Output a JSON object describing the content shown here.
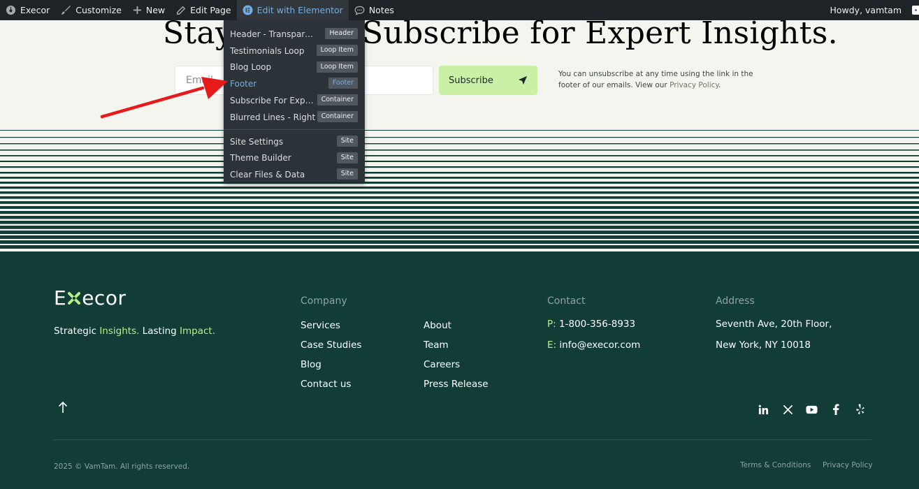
{
  "adminbar": {
    "site_name": "Execor",
    "customize": "Customize",
    "new": "New",
    "edit_page": "Edit Page",
    "edit_elementor": "Edit with Elementor",
    "notes": "Notes",
    "howdy": "Howdy, vamtam"
  },
  "dropdown": {
    "items": [
      {
        "label": "Header - Transparent",
        "tag": "Header"
      },
      {
        "label": "Testimonials Loop",
        "tag": "Loop Item"
      },
      {
        "label": "Blog Loop",
        "tag": "Loop Item"
      },
      {
        "label": "Footer",
        "tag": "Footer"
      },
      {
        "label": "Subscribe For Expert Insights",
        "tag": "Container"
      },
      {
        "label": "Blurred Lines - Right",
        "tag": "Container"
      }
    ],
    "site_items": [
      {
        "label": "Site Settings",
        "tag": "Site"
      },
      {
        "label": "Theme Builder",
        "tag": "Site"
      },
      {
        "label": "Clear Files & Data",
        "tag": "Site"
      }
    ]
  },
  "subscribe": {
    "headline": "Stay Ahead. Subscribe for Expert Insights.",
    "email_placeholder": "Email",
    "button_label": "Subscribe",
    "disclaimer_text": "You can unsubscribe at any time using the link in the footer of our emails. View our ",
    "privacy_link": "Privacy Policy",
    "disclaimer_end": "."
  },
  "footer": {
    "logo_left": "E",
    "logo_right": "ecor",
    "tagline": {
      "t1": "Strategic ",
      "t2": "Insights.",
      "t3": " Lasting ",
      "t4": "Impact."
    },
    "company_title": "Company",
    "company_links_col1": [
      "Services",
      "Case Studies",
      "Blog",
      "Contact us"
    ],
    "company_links_col2": [
      "About",
      "Team",
      "Careers",
      "Press Release"
    ],
    "contact_title": "Contact",
    "phone_prefix": "P:",
    "phone": "1-800-356-8933",
    "email_prefix": "E:",
    "email": "info@execor.com",
    "address_title": "Address",
    "address_line1": "Seventh Ave, 20th Floor,",
    "address_line2": "New York, NY 10018",
    "copyright": "2025 © VamTam. All rights reserved.",
    "terms": "Terms & Conditions",
    "privacy": "Privacy Policy",
    "social_icons": [
      "linkedin-icon",
      "x-icon",
      "youtube-icon",
      "facebook-icon",
      "yelp-icon"
    ]
  },
  "colors": {
    "adminbar_bg": "#1d2327",
    "dropdown_bg": "#2c3338",
    "accent_blue": "#72aee6",
    "page_bg": "#f4f5ef",
    "footer_bg": "#123d37",
    "lime": "#c9f0a4",
    "highlight_green": "#b8f08a",
    "arrow_red": "#e8191b"
  }
}
